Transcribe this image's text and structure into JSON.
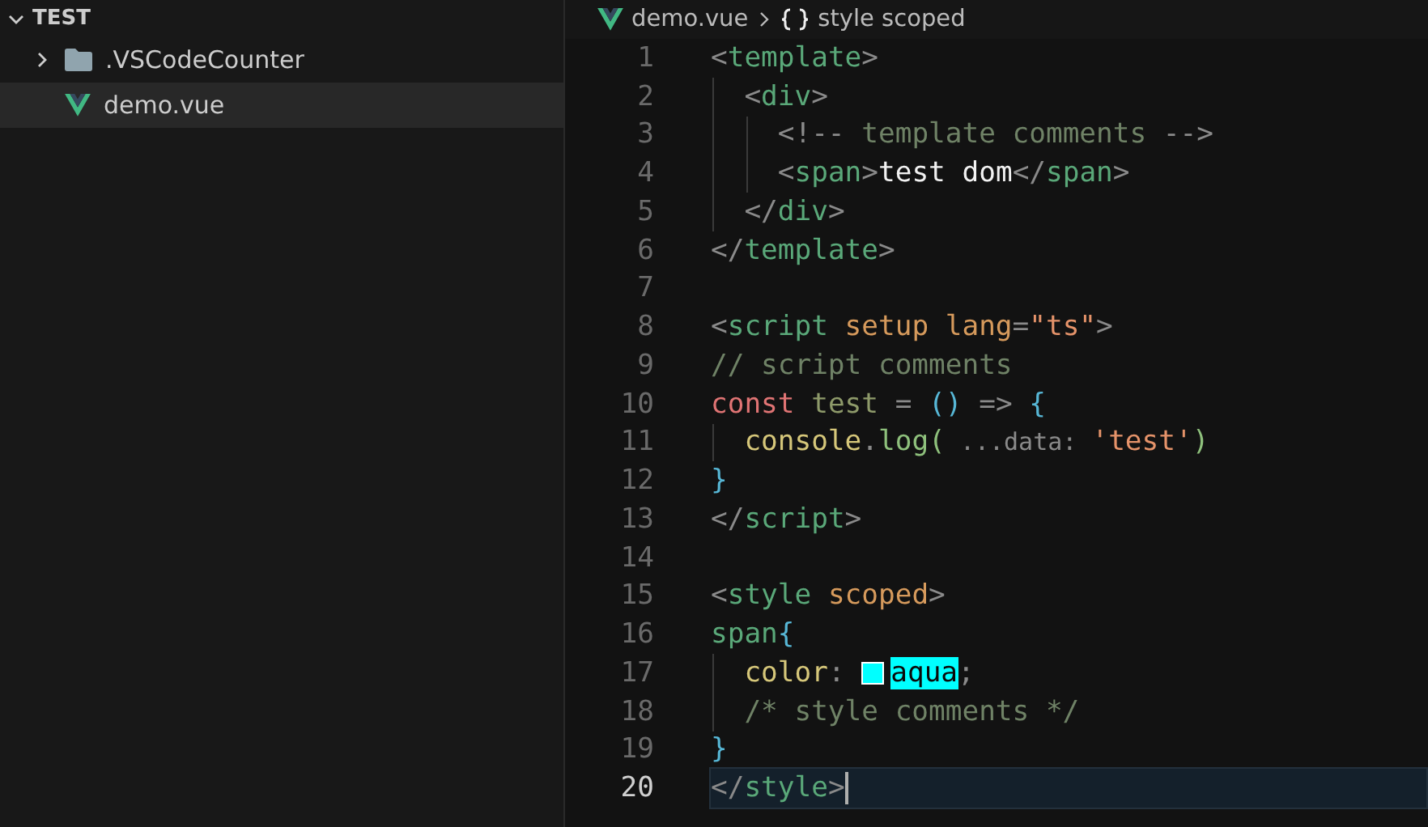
{
  "explorer": {
    "title": "TEST",
    "expanded": true,
    "items": [
      {
        "kind": "folder",
        "name": ".VSCodeCounter",
        "expanded": false,
        "selected": false
      },
      {
        "kind": "file",
        "name": "demo.vue",
        "selected": true
      }
    ]
  },
  "breadcrumb": [
    {
      "kind": "file",
      "label": "demo.vue"
    },
    {
      "kind": "symbol",
      "label": "style scoped"
    }
  ],
  "lines": [
    {
      "number": "1",
      "current": false,
      "tokens": [
        {
          "kind": "punct",
          "text": "<"
        },
        {
          "kind": "tag",
          "text": "template"
        },
        {
          "kind": "punct",
          "text": ">"
        }
      ]
    },
    {
      "number": "2",
      "current": false,
      "tokens": [
        {
          "kind": "punct",
          "text": "  <"
        },
        {
          "kind": "tag",
          "text": "div"
        },
        {
          "kind": "punct",
          "text": ">"
        }
      ]
    },
    {
      "number": "3",
      "current": false,
      "tokens": [
        {
          "kind": "punct",
          "text": "    <!--"
        },
        {
          "kind": "comment",
          "text": " template comments "
        },
        {
          "kind": "punct",
          "text": "-->"
        }
      ]
    },
    {
      "number": "4",
      "current": false,
      "tokens": [
        {
          "kind": "punct",
          "text": "    <"
        },
        {
          "kind": "tag",
          "text": "span"
        },
        {
          "kind": "punct",
          "text": ">"
        },
        {
          "kind": "plain",
          "text": "test dom"
        },
        {
          "kind": "punct",
          "text": "</"
        },
        {
          "kind": "tag",
          "text": "span"
        },
        {
          "kind": "punct",
          "text": ">"
        }
      ]
    },
    {
      "number": "5",
      "current": false,
      "tokens": [
        {
          "kind": "punct",
          "text": "  </"
        },
        {
          "kind": "tag",
          "text": "div"
        },
        {
          "kind": "punct",
          "text": ">"
        }
      ]
    },
    {
      "number": "6",
      "current": false,
      "tokens": [
        {
          "kind": "punct",
          "text": "</"
        },
        {
          "kind": "tag",
          "text": "template"
        },
        {
          "kind": "punct",
          "text": ">"
        }
      ]
    },
    {
      "number": "7",
      "current": false
    },
    {
      "number": "8",
      "current": false,
      "tokens": [
        {
          "kind": "punct",
          "text": "<"
        },
        {
          "kind": "tag",
          "text": "script"
        },
        {
          "kind": "attr",
          "text": " setup lang"
        },
        {
          "kind": "punct",
          "text": "="
        },
        {
          "kind": "string",
          "text": "\"ts\""
        },
        {
          "kind": "punct",
          "text": ">"
        }
      ]
    },
    {
      "number": "9",
      "current": false,
      "tokens": [
        {
          "kind": "comment",
          "text": "// script comments"
        }
      ]
    },
    {
      "number": "10",
      "current": false,
      "tokens": [
        {
          "kind": "keyword",
          "text": "const"
        },
        {
          "kind": "variable",
          "text": " test"
        },
        {
          "kind": "punct",
          "text": " = "
        },
        {
          "kind": "bracket",
          "text": "()"
        },
        {
          "kind": "punct",
          "text": " => "
        },
        {
          "kind": "bracket",
          "text": "{"
        }
      ]
    },
    {
      "number": "11",
      "current": false,
      "tokens": [
        {
          "kind": "function",
          "text": "  console"
        },
        {
          "kind": "punct",
          "text": "."
        },
        {
          "kind": "method",
          "text": "log("
        },
        {
          "kind": "hint",
          "text": "...data:"
        },
        {
          "kind": "string",
          "text": "'test'"
        },
        {
          "kind": "method",
          "text": ")"
        }
      ]
    },
    {
      "number": "12",
      "current": false,
      "tokens": [
        {
          "kind": "bracket",
          "text": "}"
        }
      ]
    },
    {
      "number": "13",
      "current": false,
      "tokens": [
        {
          "kind": "punct",
          "text": "</"
        },
        {
          "kind": "tag",
          "text": "script"
        },
        {
          "kind": "punct",
          "text": ">"
        }
      ]
    },
    {
      "number": "14",
      "current": false
    },
    {
      "number": "15",
      "current": false,
      "tokens": [
        {
          "kind": "punct",
          "text": "<"
        },
        {
          "kind": "tag",
          "text": "style"
        },
        {
          "kind": "attr",
          "text": " scoped"
        },
        {
          "kind": "punct",
          "text": ">"
        }
      ]
    },
    {
      "number": "16",
      "current": false,
      "tokens": [
        {
          "kind": "tag",
          "text": "span"
        },
        {
          "kind": "bracket",
          "text": "{"
        }
      ]
    },
    {
      "number": "17",
      "current": false,
      "tokens": [
        {
          "kind": "function",
          "text": "  color"
        },
        {
          "kind": "punct",
          "text": ": "
        },
        {
          "kind": "swatch",
          "color": "#00ffff"
        },
        {
          "kind": "match",
          "text": "aqua"
        },
        {
          "kind": "punct",
          "text": ";"
        }
      ]
    },
    {
      "number": "18",
      "current": false,
      "tokens": [
        {
          "kind": "comment",
          "text": "  /* style comments */"
        }
      ]
    },
    {
      "number": "19",
      "current": false,
      "tokens": [
        {
          "kind": "bracket",
          "text": "}"
        }
      ]
    },
    {
      "number": "20",
      "current": true,
      "tokens": [
        {
          "kind": "punct",
          "text": "</"
        },
        {
          "kind": "tag",
          "text": "style"
        },
        {
          "kind": "punct",
          "text": ">"
        }
      ]
    }
  ]
}
